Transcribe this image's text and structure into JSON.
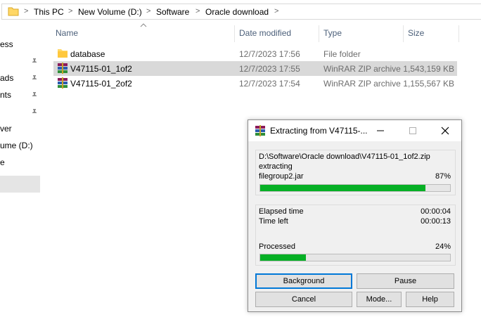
{
  "breadcrumb": [
    "This PC",
    "New Volume (D:)",
    "Software",
    "Oracle download"
  ],
  "nav": [
    "ess",
    "ads",
    "nts",
    "ver",
    "ume (D:)",
    "e"
  ],
  "columns": {
    "name": "Name",
    "date": "Date modified",
    "type": "Type",
    "size": "Size"
  },
  "files": [
    {
      "name": "database",
      "date": "12/7/2023 17:56",
      "type": "File folder",
      "size": "",
      "icon": "folder-icon"
    },
    {
      "name": "V47115-01_1of2",
      "date": "12/7/2023 17:55",
      "type": "WinRAR ZIP archive",
      "size": "1,543,159 KB",
      "icon": "winrar-archive-icon",
      "selected": true
    },
    {
      "name": "V47115-01_2of2",
      "date": "12/7/2023 17:54",
      "type": "WinRAR ZIP archive",
      "size": "1,155,567 KB",
      "icon": "winrar-archive-icon"
    }
  ],
  "dialog": {
    "title": "Extracting from V47115-...",
    "archive_path": "D:\\Software\\Oracle download\\V47115-01_1of2.zip",
    "action": "extracting",
    "current_file": "filegroup2.jar",
    "file_percent": "87%",
    "file_progress": 0.87,
    "elapsed_label": "Elapsed time",
    "elapsed_value": "00:00:04",
    "left_label": "Time left",
    "left_value": "00:00:13",
    "processed_label": "Processed",
    "processed_percent": "24%",
    "processed_progress": 0.24,
    "buttons": {
      "background": "Background",
      "pause": "Pause",
      "cancel": "Cancel",
      "mode": "Mode...",
      "help": "Help"
    }
  },
  "colors": {
    "progress": "#06b025",
    "selection": "#d9d9d9",
    "accent": "#0078d7"
  }
}
